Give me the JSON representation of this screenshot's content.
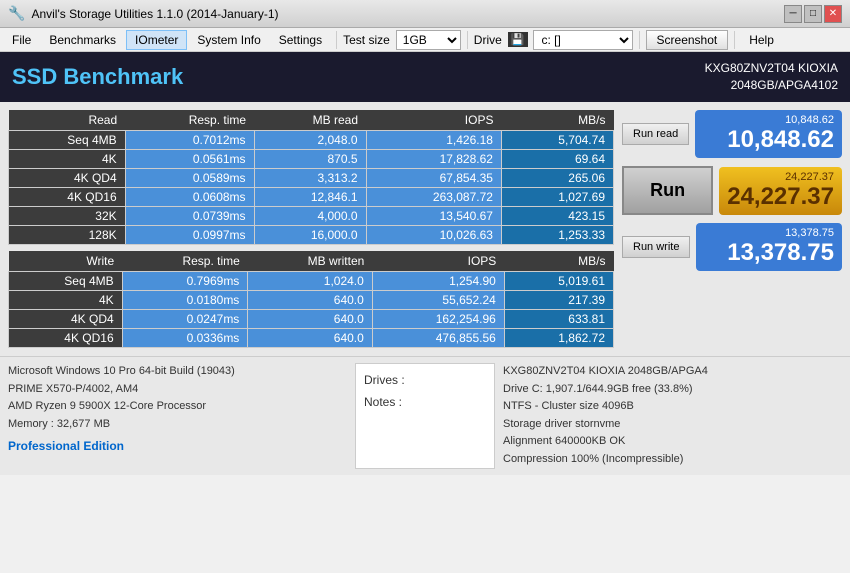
{
  "titleBar": {
    "title": "Anvil's Storage Utilities 1.1.0 (2014-January-1)",
    "icon": "🔧"
  },
  "menuBar": {
    "items": [
      "File",
      "Benchmarks",
      "IOmeter",
      "System Info",
      "Settings"
    ],
    "testSizeLabel": "Test size",
    "testSizeValue": "1GB",
    "driveLabel": "Drive",
    "driveValue": "c: []",
    "screenshotLabel": "Screenshot",
    "helpLabel": "Help"
  },
  "header": {
    "title": "SSD Benchmark",
    "deviceLine1": "KXG80ZNV2T04 KIOXIA",
    "deviceLine2": "2048GB/APGA4102"
  },
  "readTable": {
    "headers": [
      "Read",
      "Resp. time",
      "MB read",
      "IOPS",
      "MB/s"
    ],
    "rows": [
      [
        "Seq 4MB",
        "0.7012ms",
        "2,048.0",
        "1,426.18",
        "5,704.74"
      ],
      [
        "4K",
        "0.0561ms",
        "870.5",
        "17,828.62",
        "69.64"
      ],
      [
        "4K QD4",
        "0.0589ms",
        "3,313.2",
        "67,854.35",
        "265.06"
      ],
      [
        "4K QD16",
        "0.0608ms",
        "12,846.1",
        "263,087.72",
        "1,027.69"
      ],
      [
        "32K",
        "0.0739ms",
        "4,000.0",
        "13,540.67",
        "423.15"
      ],
      [
        "128K",
        "0.0997ms",
        "16,000.0",
        "10,026.63",
        "1,253.33"
      ]
    ]
  },
  "writeTable": {
    "headers": [
      "Write",
      "Resp. time",
      "MB written",
      "IOPS",
      "MB/s"
    ],
    "rows": [
      [
        "Seq 4MB",
        "0.7969ms",
        "1,024.0",
        "1,254.90",
        "5,019.61"
      ],
      [
        "4K",
        "0.0180ms",
        "640.0",
        "55,652.24",
        "217.39"
      ],
      [
        "4K QD4",
        "0.0247ms",
        "640.0",
        "162,254.96",
        "633.81"
      ],
      [
        "4K QD16",
        "0.0336ms",
        "640.0",
        "476,855.56",
        "1,862.72"
      ]
    ]
  },
  "scores": {
    "runReadLabel": "Run read",
    "runReadScore1": "10,848.62",
    "runReadScore2": "10,848.62",
    "runMainLabel": "Run",
    "runMainScore1": "24,227.37",
    "runMainScore2": "24,227.37",
    "runWriteLabel": "Run write",
    "runWriteScore1": "13,378.75",
    "runWriteScore2": "13,378.75"
  },
  "bottomLeft": {
    "os": "Microsoft Windows 10 Pro 64-bit Build (19043)",
    "motherboard": "PRIME X570-P/4002, AM4",
    "cpu": "AMD Ryzen 9 5900X 12-Core Processor",
    "memory": "Memory : 32,677 MB",
    "edition": "Professional Edition"
  },
  "bottomNotes": {
    "drivesLabel": "Drives :",
    "notesLabel": "Notes :"
  },
  "bottomRight": {
    "device": "KXG80ZNV2T04 KIOXIA 2048GB/APGA4",
    "driveInfo": "Drive C: 1,907.1/644.9GB free (33.8%)",
    "ntfs": "NTFS - Cluster size 4096B",
    "storageDriver": "Storage driver  stornvme",
    "alignment": "Alignment 640000KB OK",
    "compression": "Compression 100% (Incompressible)"
  }
}
